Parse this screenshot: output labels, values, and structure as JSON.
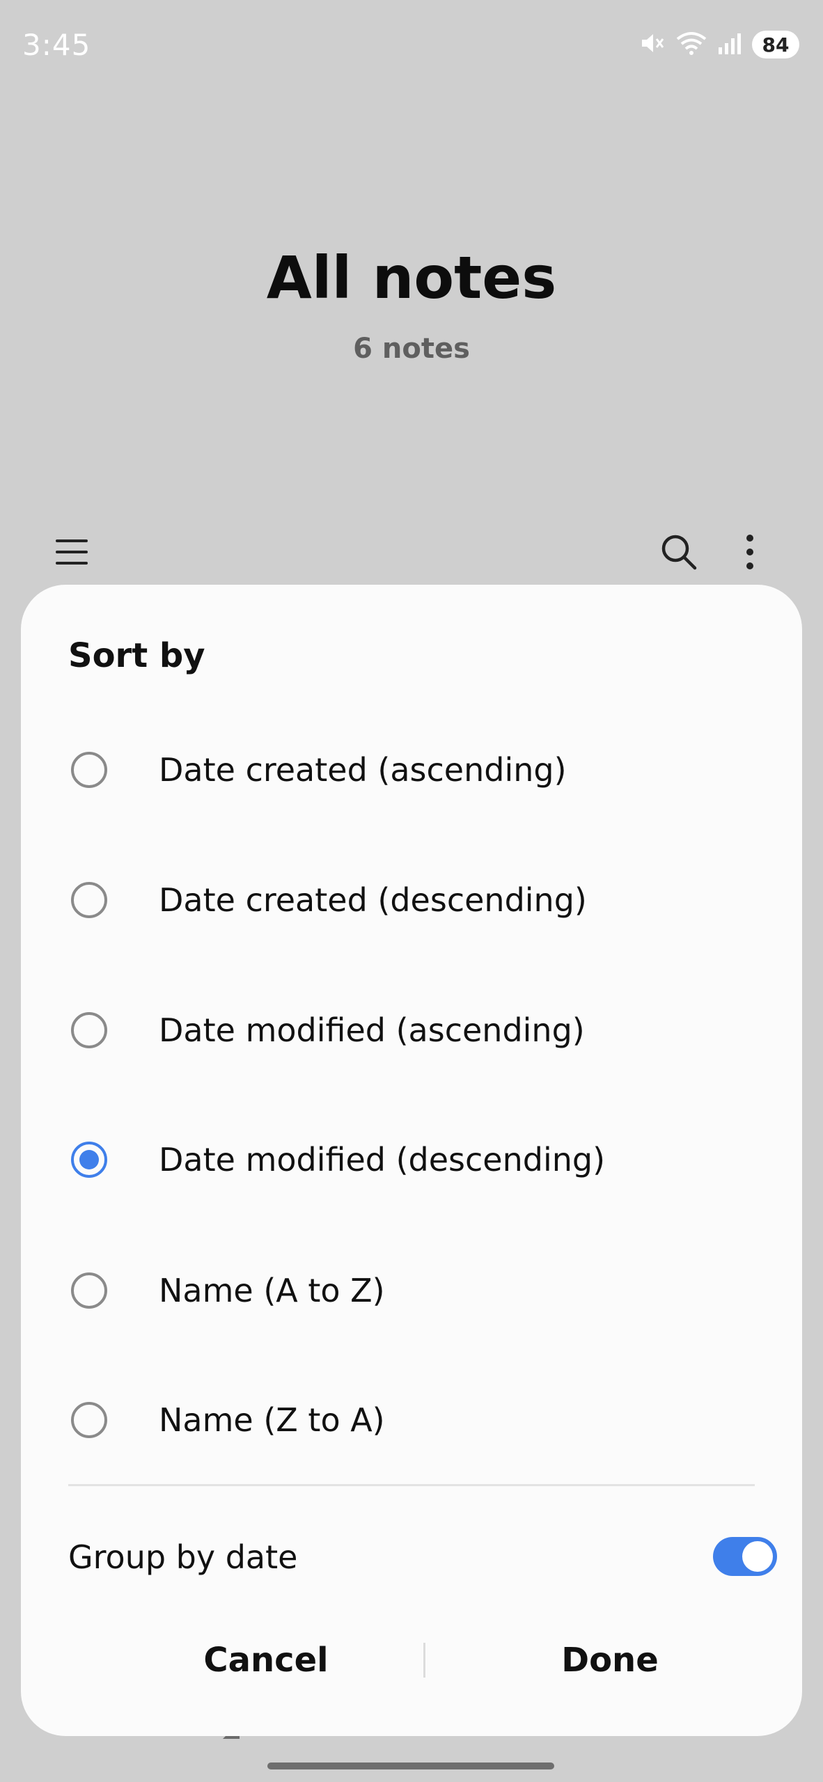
{
  "status_bar": {
    "time": "3:45",
    "battery": "84",
    "icons": [
      "mute-icon",
      "wifi-icon",
      "signal-icon",
      "battery-icon"
    ]
  },
  "header": {
    "title": "All notes",
    "subtitle": "6 notes"
  },
  "toolbar": {
    "icons": [
      "menu-icon",
      "search-icon",
      "more-options-icon"
    ]
  },
  "sort_dialog": {
    "title": "Sort by",
    "options": [
      {
        "label": "Date created (ascending)",
        "selected": false
      },
      {
        "label": "Date created (descending)",
        "selected": false
      },
      {
        "label": "Date modified (ascending)",
        "selected": false
      },
      {
        "label": "Date modified (descending)",
        "selected": true
      },
      {
        "label": "Name (A to Z)",
        "selected": false
      },
      {
        "label": "Name (Z to A)",
        "selected": false
      }
    ],
    "group_by_date": {
      "label": "Group by date",
      "enabled": true
    },
    "cancel_label": "Cancel",
    "done_label": "Done"
  },
  "colors": {
    "accent": "#3f7fea",
    "scrim_background": "#cfcfcf",
    "sheet_background": "#fbfbfb"
  }
}
